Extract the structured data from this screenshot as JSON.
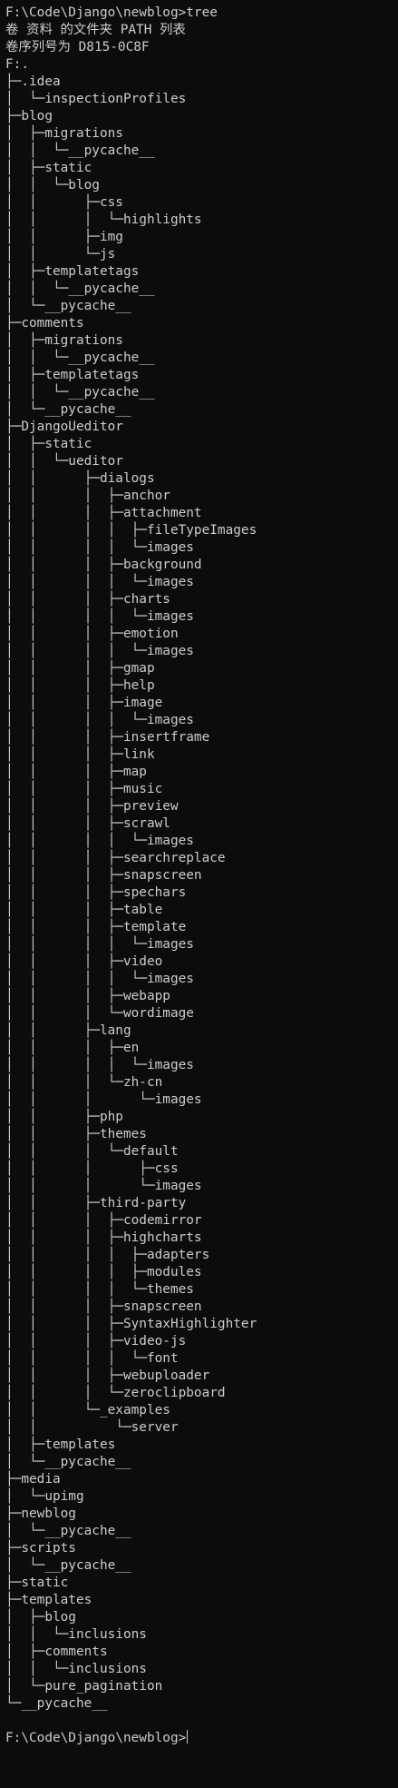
{
  "window": {
    "background": "#0c0c0c",
    "foreground": "#cccccc"
  },
  "terminal": {
    "lines": [
      "F:\\Code\\Django\\newblog>tree",
      "卷 资料 的文件夹 PATH 列表",
      "卷序列号为 D815-0C8F",
      "F:.",
      "├─.idea",
      "│  └─inspectionProfiles",
      "├─blog",
      "│  ├─migrations",
      "│  │  └─__pycache__",
      "│  ├─static",
      "│  │  └─blog",
      "│  │      ├─css",
      "│  │      │  └─highlights",
      "│  │      ├─img",
      "│  │      └─js",
      "│  ├─templatetags",
      "│  │  └─__pycache__",
      "│  └─__pycache__",
      "├─comments",
      "│  ├─migrations",
      "│  │  └─__pycache__",
      "│  ├─templatetags",
      "│  │  └─__pycache__",
      "│  └─__pycache__",
      "├─DjangoUeditor",
      "│  ├─static",
      "│  │  └─ueditor",
      "│  │      ├─dialogs",
      "│  │      │  ├─anchor",
      "│  │      │  ├─attachment",
      "│  │      │  │  ├─fileTypeImages",
      "│  │      │  │  └─images",
      "│  │      │  ├─background",
      "│  │      │  │  └─images",
      "│  │      │  ├─charts",
      "│  │      │  │  └─images",
      "│  │      │  ├─emotion",
      "│  │      │  │  └─images",
      "│  │      │  ├─gmap",
      "│  │      │  ├─help",
      "│  │      │  ├─image",
      "│  │      │  │  └─images",
      "│  │      │  ├─insertframe",
      "│  │      │  ├─link",
      "│  │      │  ├─map",
      "│  │      │  ├─music",
      "│  │      │  ├─preview",
      "│  │      │  ├─scrawl",
      "│  │      │  │  └─images",
      "│  │      │  ├─searchreplace",
      "│  │      │  ├─snapscreen",
      "│  │      │  ├─spechars",
      "│  │      │  ├─table",
      "│  │      │  ├─template",
      "│  │      │  │  └─images",
      "│  │      │  ├─video",
      "│  │      │  │  └─images",
      "│  │      │  ├─webapp",
      "│  │      │  └─wordimage",
      "│  │      ├─lang",
      "│  │      │  ├─en",
      "│  │      │  │  └─images",
      "│  │      │  └─zh-cn",
      "│  │      │      └─images",
      "│  │      ├─php",
      "│  │      ├─themes",
      "│  │      │  └─default",
      "│  │      │      ├─css",
      "│  │      │      └─images",
      "│  │      ├─third-party",
      "│  │      │  ├─codemirror",
      "│  │      │  ├─highcharts",
      "│  │      │  │  ├─adapters",
      "│  │      │  │  ├─modules",
      "│  │      │  │  └─themes",
      "│  │      │  ├─snapscreen",
      "│  │      │  ├─SyntaxHighlighter",
      "│  │      │  ├─video-js",
      "│  │      │  │  └─font",
      "│  │      │  ├─webuploader",
      "│  │      │  └─zeroclipboard",
      "│  │      └─_examples",
      "│  │          └─server",
      "│  ├─templates",
      "│  └─__pycache__",
      "├─media",
      "│  └─upimg",
      "├─newblog",
      "│  └─__pycache__",
      "├─scripts",
      "│  └─__pycache__",
      "├─static",
      "├─templates",
      "│  ├─blog",
      "│  │  └─inclusions",
      "│  ├─comments",
      "│  │  └─inclusions",
      "│  └─pure_pagination",
      "└─__pycache__",
      "",
      "F:\\Code\\Django\\newblog>"
    ]
  }
}
